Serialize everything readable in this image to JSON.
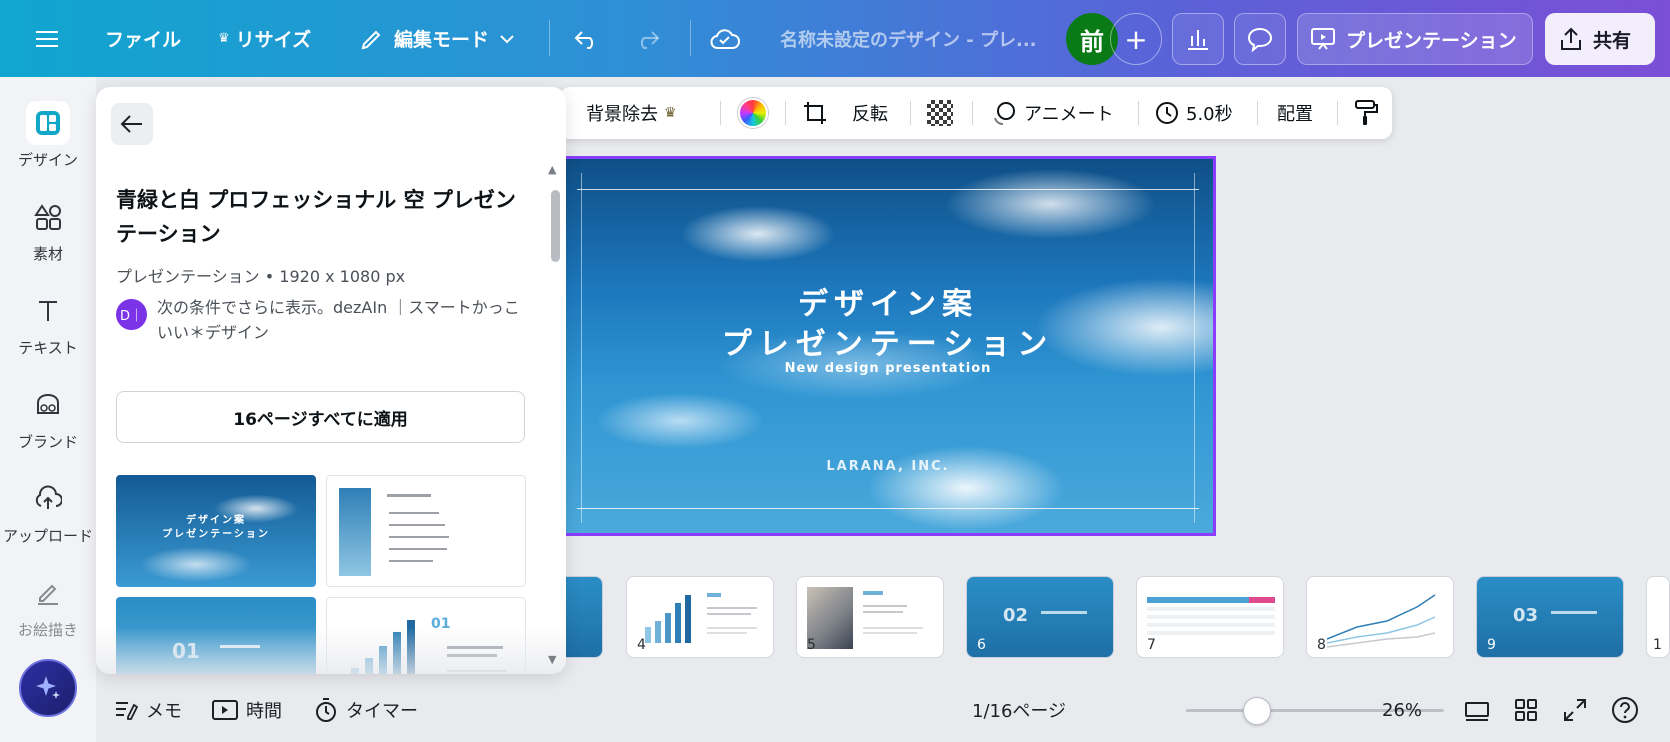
{
  "topbar": {
    "menu_label": "",
    "file": "ファイル",
    "resize": "リサイズ",
    "edit_mode": "編集モード",
    "doc_title": "名称未設定のデザイン - プレ...",
    "avatar_initial": "前",
    "present": "プレゼンテーション",
    "share": "共有",
    "colors": {
      "avatar": "#0a7a16",
      "crown": "#f5c518"
    }
  },
  "rail": {
    "items": [
      {
        "label": "デザイン",
        "icon": "design-icon"
      },
      {
        "label": "素材",
        "icon": "elements-icon"
      },
      {
        "label": "テキスト",
        "icon": "text-icon"
      },
      {
        "label": "ブランド",
        "icon": "brand-icon"
      },
      {
        "label": "アップロード",
        "icon": "upload-icon"
      },
      {
        "label": "お絵描き",
        "icon": "draw-icon"
      }
    ]
  },
  "context_toolbar": {
    "remove_bg": "背景除去",
    "flip": "反転",
    "animate": "アニメート",
    "duration": "5.0秒",
    "position": "配置"
  },
  "panel": {
    "title": "青緑と白 プロフェッショナル 空 プレゼンテーション",
    "meta": "プレゼンテーション • 1920 x 1080 px",
    "author_initial": "D｜",
    "author_text": "次の条件でさらに表示。dezAIn ｜スマートかっこいい＊デザイン",
    "apply_button": "16ページすべてに適用",
    "thumb1_title1": "デザイン案",
    "thumb1_title2": "プレゼンテーション",
    "thumb3_num": "01",
    "thumb4_num": "01"
  },
  "slide": {
    "title_line1": "デザイン案",
    "title_line2": "プレゼンテーション",
    "subtitle": "New design presentation",
    "company": "LARANA, INC."
  },
  "pages": [
    {
      "num": "",
      "big": ""
    },
    {
      "num": "4",
      "big": ""
    },
    {
      "num": "5",
      "big": ""
    },
    {
      "num": "6",
      "big": "02"
    },
    {
      "num": "7",
      "big": ""
    },
    {
      "num": "8",
      "big": ""
    },
    {
      "num": "9",
      "big": "03"
    },
    {
      "num": "1",
      "big": ""
    }
  ],
  "bottombar": {
    "notes": "メモ",
    "timing": "時間",
    "timer": "タイマー",
    "page_indicator": "1/16ページ",
    "zoom": "26%"
  }
}
